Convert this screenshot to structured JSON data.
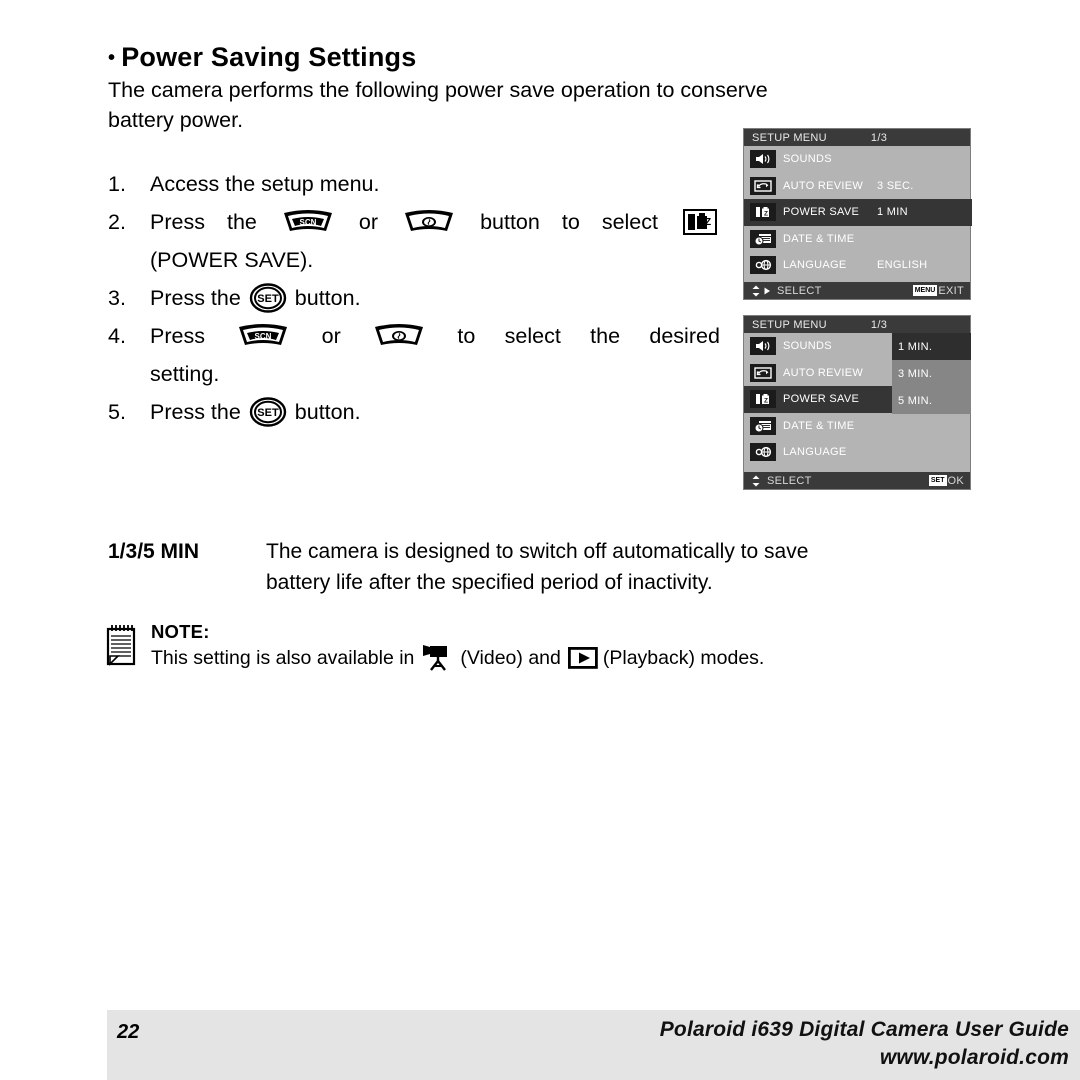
{
  "heading": {
    "bullet": "•",
    "text": "Power Saving Settings"
  },
  "intro": {
    "line1": "The camera performs the following power save operation to conserve",
    "line2": "battery power."
  },
  "steps": [
    {
      "num": "1.",
      "text": "Access the setup menu."
    },
    {
      "num": "2.",
      "part_a": "Press",
      "part_b": "the",
      "icon_a": "scn-button-icon",
      "part_c": "or",
      "icon_b": "self-timer-button-icon",
      "part_d": "button",
      "part_e": "to",
      "part_f": "select",
      "icon_c": "power-save-icon",
      "line2": "(POWER SAVE)."
    },
    {
      "num": "3.",
      "part_a": "Press the",
      "icon_a": "set-button-icon",
      "part_b": "button."
    },
    {
      "num": "4.",
      "part_a": "Press",
      "icon_a": "scn-button-icon",
      "part_b": "or",
      "icon_b": "self-timer-button-icon",
      "part_c": "to",
      "part_d": "select",
      "part_e": "the",
      "part_f": "desired",
      "line2": "setting."
    },
    {
      "num": "5.",
      "part_a": "Press the",
      "icon_a": "set-button-icon",
      "part_b": "button."
    }
  ],
  "lcd1": {
    "title": "SETUP MENU",
    "page": "1/3",
    "rows": [
      {
        "icon": "speaker-icon",
        "label": "SOUNDS",
        "value": "",
        "selected": false
      },
      {
        "icon": "auto-review-icon",
        "label": "AUTO REVIEW",
        "value": "3 SEC.",
        "selected": false
      },
      {
        "icon": "power-save-icon",
        "label": "POWER SAVE",
        "value": "1 MIN",
        "selected": true
      },
      {
        "icon": "date-time-icon",
        "label": "DATE & TIME",
        "value": "",
        "selected": false
      },
      {
        "icon": "language-icon",
        "label": "LANGUAGE",
        "value": "ENGLISH",
        "selected": false
      }
    ],
    "footer": {
      "select_label": "SELECT",
      "action_badge": "MENU",
      "action_label": "EXIT"
    }
  },
  "lcd2": {
    "title": "SETUP MENU",
    "page": "1/3",
    "rows": [
      {
        "icon": "speaker-icon",
        "label": "SOUNDS",
        "selected": false
      },
      {
        "icon": "auto-review-icon",
        "label": "AUTO REVIEW",
        "selected": false
      },
      {
        "icon": "power-save-icon",
        "label": "POWER SAVE",
        "selected": true
      },
      {
        "icon": "date-time-icon",
        "label": "DATE & TIME",
        "selected": false
      },
      {
        "icon": "language-icon",
        "label": "LANGUAGE",
        "selected": false
      }
    ],
    "submenu": [
      {
        "label": "1 MIN.",
        "selected": true
      },
      {
        "label": "3 MIN.",
        "selected": false
      },
      {
        "label": "5 MIN.",
        "selected": false
      }
    ],
    "footer": {
      "select_label": "SELECT",
      "action_badge": "SET",
      "action_label": "OK"
    }
  },
  "min_block": {
    "term": "1/3/5 MIN",
    "line1": "The camera is designed to switch off automatically to save",
    "line2": "battery life after the specified period of inactivity."
  },
  "note": {
    "title": "NOTE:",
    "text_a": "This setting is also available in",
    "icon_a": "video-mode-icon",
    "text_b": "(Video) and",
    "icon_b": "playback-mode-icon",
    "text_c": "(Playback) modes."
  },
  "footer": {
    "page_number": "22",
    "title": "Polaroid i639 Digital Camera User Guide",
    "url": "www.polaroid.com"
  },
  "colors": {
    "lcd_background": "#b4b4b4",
    "lcd_bar": "#3a3a3a",
    "lcd_selected": "#353535",
    "submenu_background": "#868686",
    "footer_band": "#e4e4e4"
  }
}
